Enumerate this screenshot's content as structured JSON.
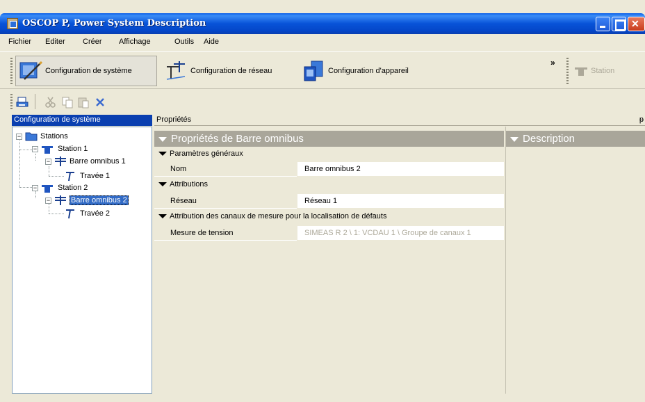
{
  "window": {
    "title": "OSCOP P, Power System Description"
  },
  "menu": [
    "Fichier",
    "Editer",
    "Créer",
    "Affichage",
    "Outils",
    "Aide"
  ],
  "toolbar": {
    "system_config": "Configuration de système",
    "network_config": "Configuration de réseau",
    "device_config": "Configuration d'appareil",
    "overflow": "»",
    "station": "Station"
  },
  "left_panel": {
    "header": "Configuration de système",
    "tree": {
      "root": "Stations",
      "station1": "Station 1",
      "busbar1": "Barre omnibus 1",
      "bay1": "Travée 1",
      "station2": "Station 2",
      "busbar2": "Barre omnibus 2",
      "bay2": "Travée 2"
    }
  },
  "properties": {
    "header": "Propriétés",
    "pin": "ᵽ",
    "section_title": "Propriétés de Barre omnibus",
    "description_title": "Description",
    "cat_general": "Paramètres généraux",
    "name_label": "Nom",
    "name_value": "Barre omnibus 2",
    "cat_attributions": "Attributions",
    "network_label": "Réseau",
    "network_value": "Réseau 1",
    "cat_channels": "Attribution des canaux de mesure pour la localisation de défauts",
    "voltage_label": "Mesure de tension",
    "voltage_value": "SIMEAS R 2 \\ 1: VCDAU 1 \\ Groupe de canaux 1"
  },
  "colors": {
    "titlebar": "#0853d8",
    "selection": "#316ac5",
    "section_header": "#a9a69a",
    "face": "#ece9d8"
  }
}
